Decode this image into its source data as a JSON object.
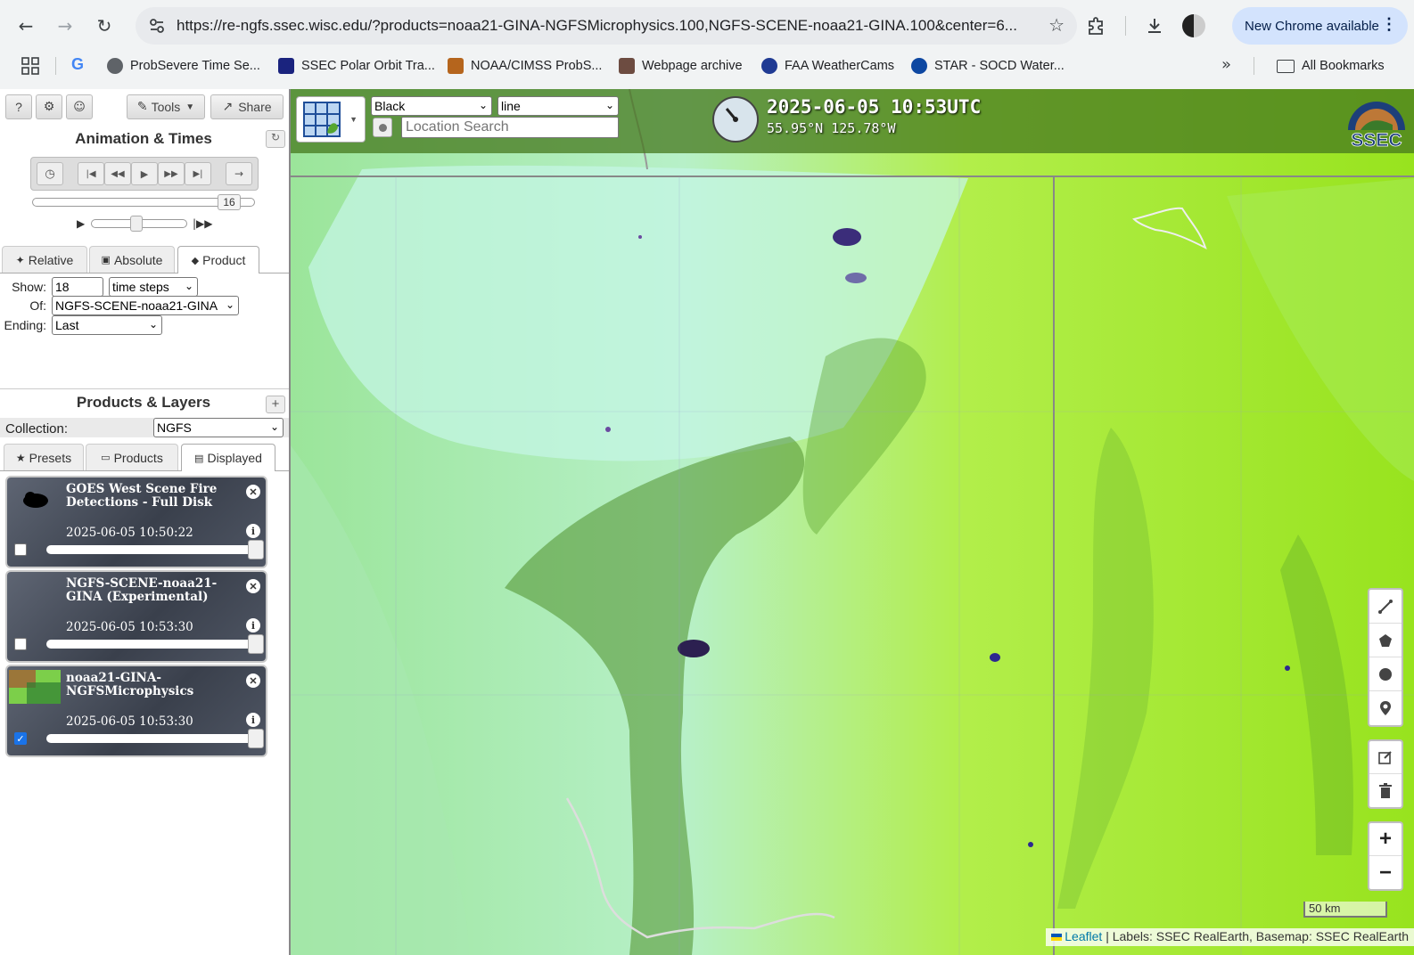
{
  "browser": {
    "url": "https://re-ngfs.ssec.wisc.edu/?products=noaa21-GINA-NGFSMicrophysics.100,NGFS-SCENE-noaa21-GINA.100&center=6...",
    "update_label": "New Chrome available",
    "bookmarks": [
      {
        "label": "ProbSevere Time Se...",
        "color": "#5f6368"
      },
      {
        "label": "SSEC Polar Orbit Tra...",
        "color": "#1a237e"
      },
      {
        "label": "NOAA/CIMSS ProbS...",
        "color": "#b5651d"
      },
      {
        "label": "Webpage archive",
        "color": "#6d4c41"
      },
      {
        "label": "FAA WeatherCams",
        "color": "#1f3a93"
      },
      {
        "label": "STAR - SOCD Water...",
        "color": "#0d47a1"
      }
    ],
    "all_bookmarks_label": "All Bookmarks"
  },
  "panel": {
    "help_label": "?",
    "tools_label": "Tools",
    "share_label": "Share",
    "animation_title": "Animation & Times",
    "frame_number": "16",
    "time_tabs": [
      "Relative",
      "Absolute",
      "Product"
    ],
    "show_label": "Show:",
    "show_value": "18",
    "show_unit": "time steps",
    "of_label": "Of:",
    "of_value": "NGFS-SCENE-noaa21-GINA",
    "ending_label": "Ending:",
    "ending_value": "Last",
    "products_title": "Products & Layers",
    "collection_label": "Collection:",
    "collection_value": "NGFS",
    "layer_tabs": [
      "Presets",
      "Products",
      "Displayed"
    ],
    "layers": [
      {
        "title": "GOES West Scene Fire Detections - Full Disk",
        "time": "2025-06-05 10:50:22",
        "checked": false
      },
      {
        "title": "NGFS-SCENE-noaa21-GINA (Experimental)",
        "time": "2025-06-05 10:53:30",
        "checked": false
      },
      {
        "title": "noaa21-GINA-NGFSMicrophysics",
        "time": "2025-06-05 10:53:30",
        "checked": true
      }
    ]
  },
  "map": {
    "color_select": "Black",
    "style_select": "line",
    "search_placeholder": "Location Search",
    "datetime": "2025-06-05 10:53UTC",
    "coords": "55.95°N 125.78°W",
    "logo_text": "SSEC",
    "scale_label": "50 km",
    "attribution_link": "Leaflet",
    "attribution_text": "| Labels: SSEC RealEarth, Basemap: SSEC RealEarth"
  }
}
